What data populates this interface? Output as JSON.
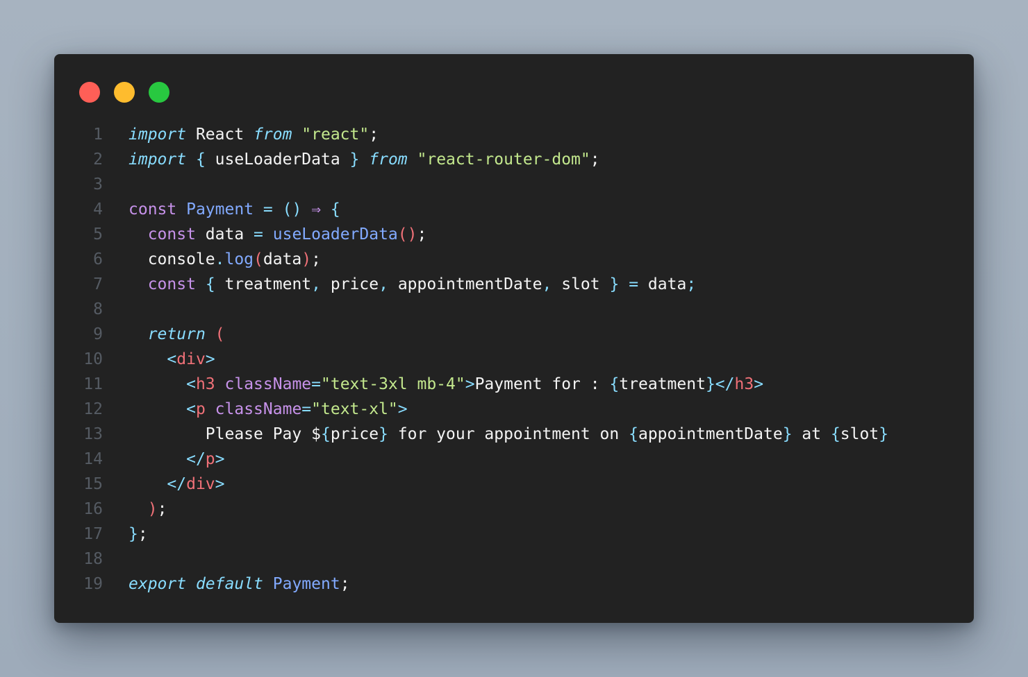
{
  "window": {
    "buttons": {
      "close_color": "#ff5f57",
      "minimize_color": "#febc2e",
      "maximize_color": "#28c840"
    }
  },
  "code": {
    "lines": [
      {
        "number": "1",
        "tokens": [
          [
            "kw-i",
            "import"
          ],
          [
            "txt",
            " React "
          ],
          [
            "kw-i",
            "from"
          ],
          [
            "txt",
            " "
          ],
          [
            "str",
            "\"react\""
          ],
          [
            "txt",
            ";"
          ]
        ]
      },
      {
        "number": "2",
        "tokens": [
          [
            "kw-i",
            "import"
          ],
          [
            "txt",
            " "
          ],
          [
            "punc",
            "{"
          ],
          [
            "txt",
            " useLoaderData "
          ],
          [
            "punc",
            "}"
          ],
          [
            "txt",
            " "
          ],
          [
            "kw-i",
            "from"
          ],
          [
            "txt",
            " "
          ],
          [
            "str",
            "\"react-router-dom\""
          ],
          [
            "txt",
            ";"
          ]
        ]
      },
      {
        "number": "3",
        "tokens": []
      },
      {
        "number": "4",
        "tokens": [
          [
            "kw",
            "const"
          ],
          [
            "txt",
            " "
          ],
          [
            "fn",
            "Payment"
          ],
          [
            "txt",
            " "
          ],
          [
            "punc",
            "="
          ],
          [
            "txt",
            " "
          ],
          [
            "punc",
            "()"
          ],
          [
            "txt",
            " "
          ],
          [
            "kw",
            "⇒"
          ],
          [
            "txt",
            " "
          ],
          [
            "punc",
            "{"
          ]
        ]
      },
      {
        "number": "5",
        "tokens": [
          [
            "txt",
            "  "
          ],
          [
            "kw",
            "const"
          ],
          [
            "txt",
            " data "
          ],
          [
            "punc",
            "="
          ],
          [
            "txt",
            " "
          ],
          [
            "fn",
            "useLoaderData"
          ],
          [
            "paren",
            "()"
          ],
          [
            "txt",
            ";"
          ]
        ]
      },
      {
        "number": "6",
        "tokens": [
          [
            "txt",
            "  console"
          ],
          [
            "punc",
            "."
          ],
          [
            "fn",
            "log"
          ],
          [
            "paren",
            "("
          ],
          [
            "txt",
            "data"
          ],
          [
            "paren",
            ")"
          ],
          [
            "txt",
            ";"
          ]
        ]
      },
      {
        "number": "7",
        "tokens": [
          [
            "txt",
            "  "
          ],
          [
            "kw",
            "const"
          ],
          [
            "txt",
            " "
          ],
          [
            "punc",
            "{"
          ],
          [
            "txt",
            " treatment"
          ],
          [
            "punc",
            ","
          ],
          [
            "txt",
            " price"
          ],
          [
            "punc",
            ","
          ],
          [
            "txt",
            " appointmentDate"
          ],
          [
            "punc",
            ","
          ],
          [
            "txt",
            " slot "
          ],
          [
            "punc",
            "}"
          ],
          [
            "txt",
            " "
          ],
          [
            "punc",
            "="
          ],
          [
            "txt",
            " data"
          ],
          [
            "punc",
            ";"
          ]
        ]
      },
      {
        "number": "8",
        "tokens": []
      },
      {
        "number": "9",
        "tokens": [
          [
            "txt",
            "  "
          ],
          [
            "kw-i",
            "return"
          ],
          [
            "txt",
            " "
          ],
          [
            "paren",
            "("
          ]
        ]
      },
      {
        "number": "10",
        "tokens": [
          [
            "txt",
            "    "
          ],
          [
            "punc",
            "<"
          ],
          [
            "tag",
            "div"
          ],
          [
            "punc",
            ">"
          ]
        ]
      },
      {
        "number": "11",
        "tokens": [
          [
            "txt",
            "      "
          ],
          [
            "punc",
            "<"
          ],
          [
            "tag",
            "h3"
          ],
          [
            "txt",
            " "
          ],
          [
            "attr",
            "className"
          ],
          [
            "punc",
            "="
          ],
          [
            "str",
            "\"text-3xl mb-4\""
          ],
          [
            "punc",
            ">"
          ],
          [
            "txt",
            "Payment for : "
          ],
          [
            "punc",
            "{"
          ],
          [
            "txt",
            "treatment"
          ],
          [
            "punc",
            "}</"
          ],
          [
            "tag",
            "h3"
          ],
          [
            "punc",
            ">"
          ]
        ]
      },
      {
        "number": "12",
        "tokens": [
          [
            "txt",
            "      "
          ],
          [
            "punc",
            "<"
          ],
          [
            "tag",
            "p"
          ],
          [
            "txt",
            " "
          ],
          [
            "attr",
            "className"
          ],
          [
            "punc",
            "="
          ],
          [
            "str",
            "\"text-xl\""
          ],
          [
            "punc",
            ">"
          ]
        ]
      },
      {
        "number": "13",
        "tokens": [
          [
            "txt",
            "        Please Pay $"
          ],
          [
            "punc",
            "{"
          ],
          [
            "txt",
            "price"
          ],
          [
            "punc",
            "}"
          ],
          [
            "txt",
            " for your appointment on "
          ],
          [
            "punc",
            "{"
          ],
          [
            "txt",
            "appointmentDate"
          ],
          [
            "punc",
            "}"
          ],
          [
            "txt",
            " at "
          ],
          [
            "punc",
            "{"
          ],
          [
            "txt",
            "slot"
          ],
          [
            "punc",
            "}"
          ]
        ]
      },
      {
        "number": "14",
        "tokens": [
          [
            "txt",
            "      "
          ],
          [
            "punc",
            "</"
          ],
          [
            "tag",
            "p"
          ],
          [
            "punc",
            ">"
          ]
        ]
      },
      {
        "number": "15",
        "tokens": [
          [
            "txt",
            "    "
          ],
          [
            "punc",
            "</"
          ],
          [
            "tag",
            "div"
          ],
          [
            "punc",
            ">"
          ]
        ]
      },
      {
        "number": "16",
        "tokens": [
          [
            "txt",
            "  "
          ],
          [
            "paren",
            ")"
          ],
          [
            "txt",
            ";"
          ]
        ]
      },
      {
        "number": "17",
        "tokens": [
          [
            "punc",
            "}"
          ],
          [
            "txt",
            ";"
          ]
        ]
      },
      {
        "number": "18",
        "tokens": []
      },
      {
        "number": "19",
        "tokens": [
          [
            "kw-i",
            "export"
          ],
          [
            "txt",
            " "
          ],
          [
            "kw-i",
            "default"
          ],
          [
            "txt",
            " "
          ],
          [
            "fn",
            "Payment"
          ],
          [
            "txt",
            ";"
          ]
        ]
      }
    ]
  }
}
